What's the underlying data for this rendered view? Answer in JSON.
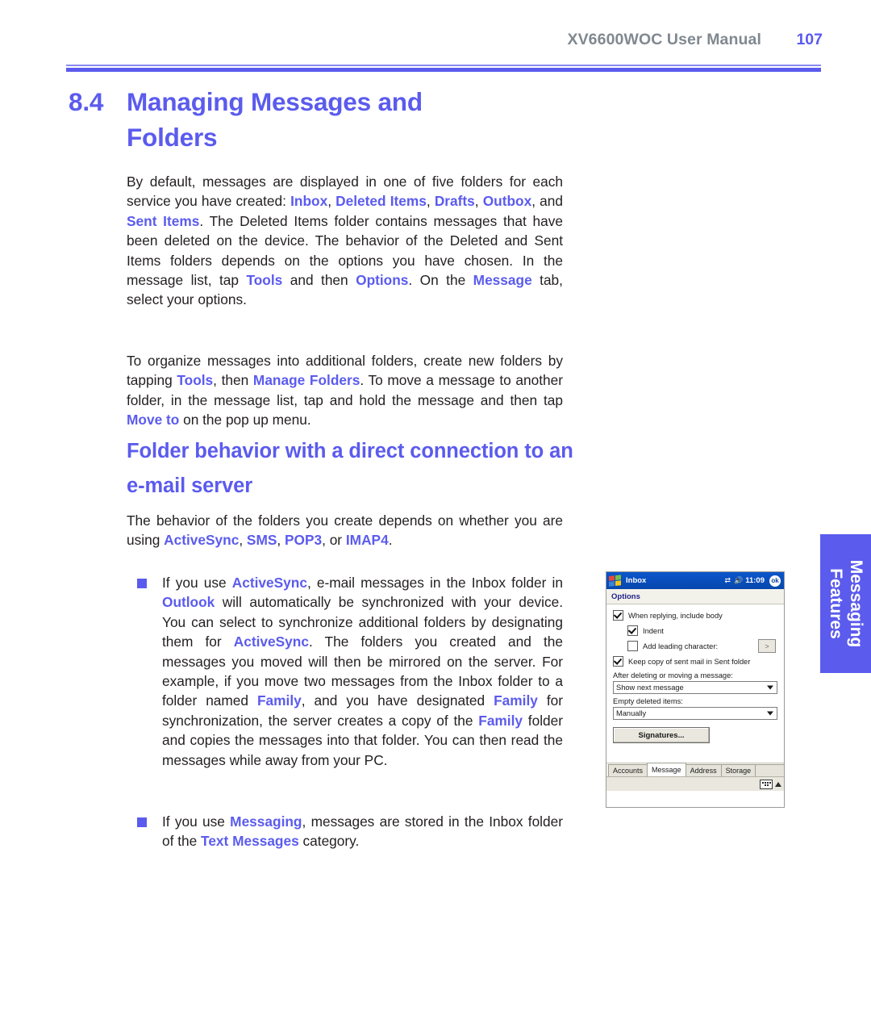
{
  "header": {
    "title": "XV6600WOC User Manual",
    "page_number": "107"
  },
  "heading": {
    "number": "8.4",
    "line1": "Managing Messages and",
    "line2": "Folders"
  },
  "subheading": {
    "line1": "Folder behavior with a direct",
    "line2": "connection to an e-mail server"
  },
  "paragraphs": {
    "p1_part1": "By default, messages are displayed in one of five folders for each service you have created: ",
    "p1_inbox": "Inbox",
    "p1_sep1": ", ",
    "p1_deleted": "Deleted Items",
    "p1_sep2": ", ",
    "p1_drafts": "Drafts",
    "p1_sep3": ", ",
    "p1_outbox": "Outbox",
    "p1_sep4": ", and ",
    "p1_sent": "Sent Items",
    "p1_part2": ". The Deleted Items folder contains messages that have been deleted on the device. The behavior of the Deleted and Sent Items folders depends on the options you have chosen. In the message list, tap ",
    "p1_tools": "Tools",
    "p1_part3": " and then ",
    "p1_options": "Options",
    "p1_part4": ". On the ",
    "p1_message": "Message",
    "p1_part5": " tab, select your options.",
    "p2_part1": "To organize messages into additional folders, create new folders by tapping ",
    "p2_tools": "Tools",
    "p2_part2": ", then ",
    "p2_manage": "Manage Folders",
    "p2_part3": ". To move a message to another folder, in the message list, tap and hold the message and then tap ",
    "p2_moveto": "Move to",
    "p2_part4": " on the pop up menu.",
    "p3_part1": "The behavior of the folders you create depends on whether you are using ",
    "p3_activesync": "ActiveSync",
    "p3_sep1": ", ",
    "p3_sms": "SMS",
    "p3_sep2": ", ",
    "p3_pop3": "POP3",
    "p3_sep3": ", or ",
    "p3_imap4": "IMAP4",
    "p3_part2": "."
  },
  "bullets": {
    "b1_part1": "If you use ",
    "b1_activesync1": "ActiveSync",
    "b1_part2": ", e-mail messages in the Inbox folder in ",
    "b1_outlook": "Outlook",
    "b1_part3": " will automatically be synchronized with your device. You can select to synchronize additional folders by designating them for ",
    "b1_activesync2": "ActiveSync",
    "b1_part4": ". The folders you created and the messages you moved will then be mirrored on the server. For example, if you move two messages from the Inbox folder to a folder named ",
    "b1_family1": "Family",
    "b1_part5": ", and you have designated ",
    "b1_family2": "Family",
    "b1_part6": " for synchronization, the server creates a copy of the ",
    "b1_family3": "Family",
    "b1_part7": " folder and copies the messages into that folder. You can then read the messages while away from your PC.",
    "b2_part1": "If you use ",
    "b2_messaging": "Messaging",
    "b2_part2": ", messages are stored in the Inbox folder of the ",
    "b2_textmessages": "Text Messages",
    "b2_part3": " category."
  },
  "side_tab": {
    "line1": "Messaging",
    "line2": "Features"
  },
  "pda": {
    "titlebar": {
      "app_title": "Inbox",
      "time": "11:09",
      "ok_label": "ok"
    },
    "menubar": {
      "label": "Options"
    },
    "options": [
      {
        "label": "When replying, include body",
        "checked": true,
        "indent": 0
      },
      {
        "label": "Indent",
        "checked": true,
        "indent": 1
      },
      {
        "label": "Add leading character:",
        "checked": false,
        "indent": 1,
        "field_value": ">"
      },
      {
        "label": "Keep copy of sent mail in Sent folder",
        "checked": true,
        "indent": 0
      }
    ],
    "fields": [
      {
        "label": "After deleting or moving a message:",
        "value": "Show next message"
      },
      {
        "label": "Empty deleted items:",
        "value": "Manually"
      }
    ],
    "signatures_button": "Signatures...",
    "tabs": [
      {
        "label": "Accounts",
        "active": false
      },
      {
        "label": "Message",
        "active": true
      },
      {
        "label": "Address",
        "active": false
      },
      {
        "label": "Storage",
        "active": false
      }
    ]
  },
  "colors": {
    "accent": "#5b5bee",
    "header_gray": "#808890",
    "body_text": "#231f20",
    "pda_titlebar": "#0b4fbe"
  }
}
